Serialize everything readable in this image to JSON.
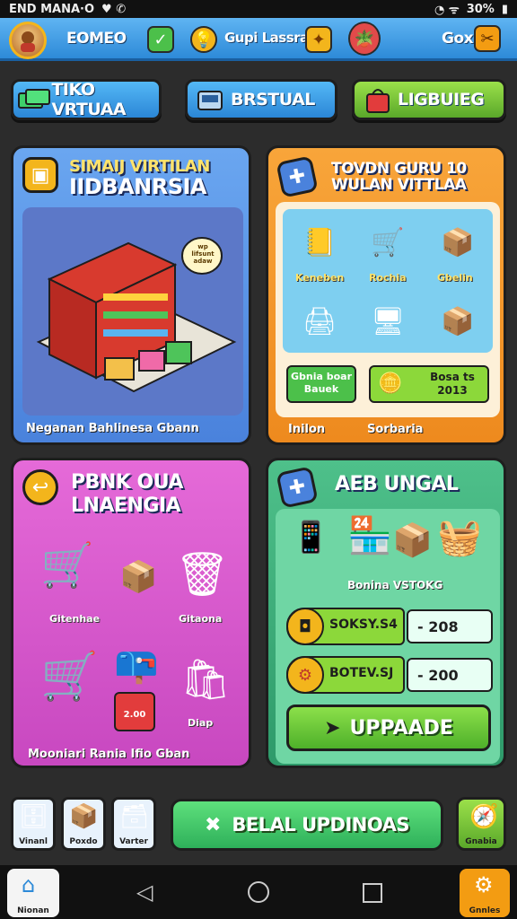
{
  "status": {
    "left": "END MANA·O",
    "right": "30%"
  },
  "topbar": {
    "avatar_text": "",
    "left_label": "EOMEO",
    "center_label": "Gupi Lassrar",
    "right_label": "Gox",
    "icons": [
      "check-icon",
      "bulb-icon",
      "star-icon",
      "pot-icon",
      "settings-icon"
    ]
  },
  "buttons": {
    "b1": "TIKO VRTUAA",
    "b2": "BRSTUAL",
    "b3": "LIGBUIEG"
  },
  "panel_store": {
    "title1": "SIMAIJ VIRTILAN",
    "title2": "IIDBANRSIA",
    "speech": "wp lifsunt adaw",
    "caption": "Neganan Bahlinesa Gbann"
  },
  "panel_tools": {
    "title1": "TOVDN GURU 10",
    "title2": "WULAN VITTLAA",
    "items": [
      "Keneben",
      "Rochia",
      "Gbelin",
      "",
      "",
      ""
    ],
    "btn_left": "Gbnia boar Bauek",
    "btn_right": "Bosa ts 2013",
    "caption_left": "Inilon",
    "caption_right": "Sorbaria"
  },
  "panel_shop": {
    "title1": "PBNK OUA",
    "title2": "LNAENGIA",
    "items": [
      "Gitenhae",
      "Gitaona",
      "",
      "Diap"
    ],
    "price": "2.00",
    "caption": "Mooniari Rania Ifio Gban"
  },
  "panel_upgrade": {
    "title": "AEB UNGAL",
    "caption": "Bonina VSTOKG",
    "stat1_label": "SOKSY.S4",
    "stat1_value": "- 208",
    "stat2_label": "BOTEV.SJ",
    "stat2_value": "- 200",
    "upgrade_btn": "UPPAADE"
  },
  "bottom": {
    "small1": "Vinanl",
    "small2": "Poxdo",
    "small3": "Varter",
    "main_btn": "BELAL UPDINOAS",
    "right_btn": "Gnabia"
  },
  "navbar": {
    "home_label": "Nionan",
    "settings_label": "Gnnles"
  }
}
